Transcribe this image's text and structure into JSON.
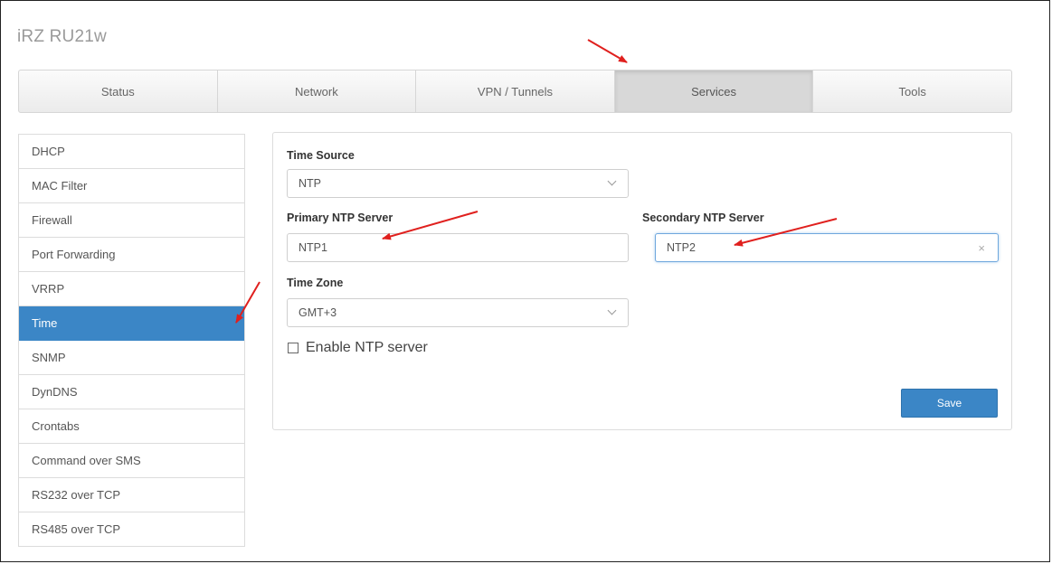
{
  "app": {
    "title": "iRZ RU21w"
  },
  "tabs": [
    {
      "label": "Status"
    },
    {
      "label": "Network"
    },
    {
      "label": "VPN / Tunnels"
    },
    {
      "label": "Services"
    },
    {
      "label": "Tools"
    }
  ],
  "active_tab": "Services",
  "sidebar": {
    "items": [
      {
        "label": "DHCP"
      },
      {
        "label": "MAC Filter"
      },
      {
        "label": "Firewall"
      },
      {
        "label": "Port Forwarding"
      },
      {
        "label": "VRRP"
      },
      {
        "label": "Time"
      },
      {
        "label": "SNMP"
      },
      {
        "label": "DynDNS"
      },
      {
        "label": "Crontabs"
      },
      {
        "label": "Command over SMS"
      },
      {
        "label": "RS232 over TCP"
      },
      {
        "label": "RS485 over TCP"
      }
    ],
    "active": "Time"
  },
  "form": {
    "time_source": {
      "label": "Time Source",
      "value": "NTP"
    },
    "primary_ntp": {
      "label": "Primary NTP Server",
      "value": "NTP1"
    },
    "secondary_ntp": {
      "label": "Secondary NTP Server",
      "value": "NTP2"
    },
    "time_zone": {
      "label": "Time Zone",
      "value": "GMT+3"
    },
    "enable_ntp": {
      "label": "Enable NTP server",
      "checked": false
    },
    "save_label": "Save"
  },
  "colors": {
    "accent": "#3b86c6",
    "annotation": "#e0201e"
  },
  "icons": {
    "select": "chevron-down-icon",
    "clear": "close-icon",
    "annotation": "red-arrow-icon"
  }
}
